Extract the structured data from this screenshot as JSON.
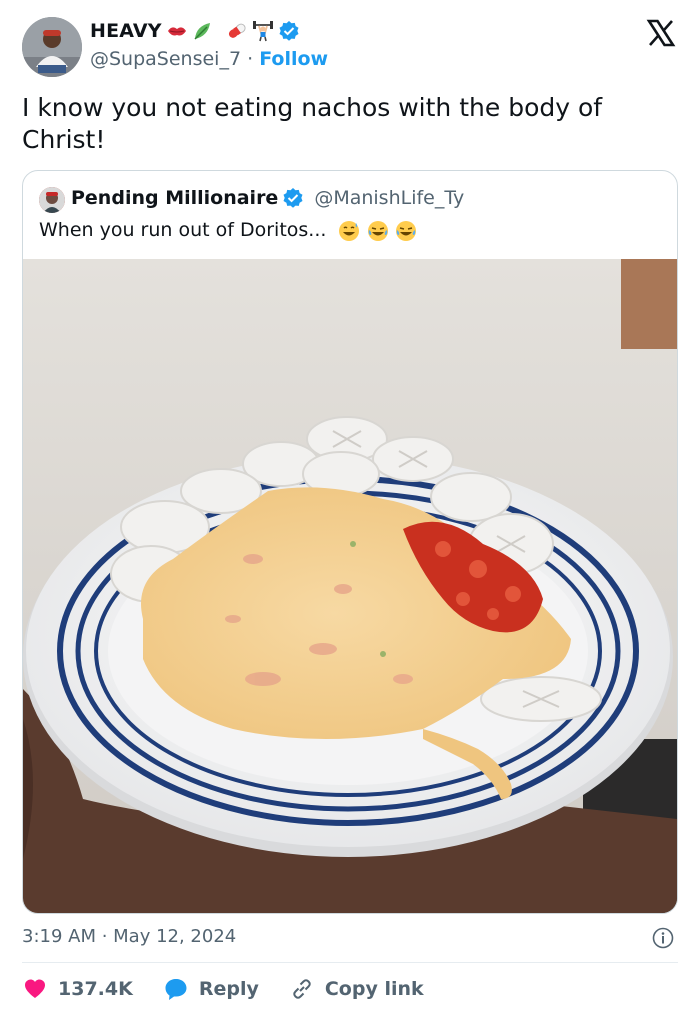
{
  "post": {
    "author_name": "HEAVY",
    "author_handle": "@SupaSensei_7",
    "separator": "·",
    "follow_label": "Follow",
    "text": "I know you not eating nachos with the body of Christ!",
    "timestamp": "3:19 AM · May 12, 2024"
  },
  "quoted": {
    "name": "Pending Millionaire",
    "handle": "@ManishLife_Ty",
    "text": "When you run out of Doritos..."
  },
  "actions": {
    "likes": "137.4K",
    "reply_label": "Reply",
    "copy_label": "Copy link"
  },
  "colors": {
    "accent": "#1d9bf0",
    "like": "#f91880",
    "text": "#0f1419",
    "muted": "#536471"
  },
  "icons": {
    "name_emojis": [
      "lips",
      "leafy-green",
      "pill",
      "weightlifter"
    ],
    "quote_emojis": [
      "grinning-sweat",
      "tears-of-joy",
      "tears-of-joy"
    ]
  }
}
